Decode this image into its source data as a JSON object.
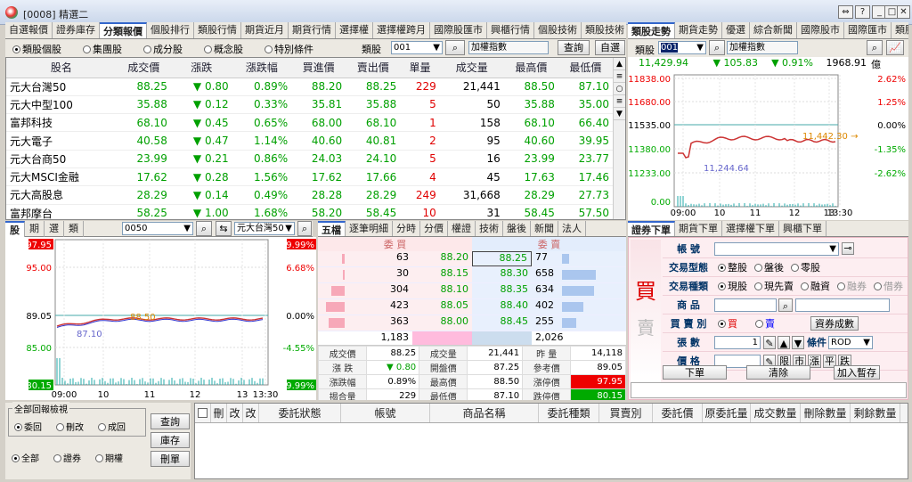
{
  "window": {
    "title": "[0008] 精選二",
    "buttons": [
      "⇔",
      "?",
      "_",
      "□",
      "✕"
    ]
  },
  "main_tabs": [
    "自選報價",
    "證券庫存",
    "分類報價",
    "個股排行",
    "類股行情",
    "期貨近月",
    "期貨行情",
    "選擇權",
    "選擇權跨月",
    "國際股匯市",
    "興櫃行情",
    "個股技術",
    "類股技術",
    "期"
  ],
  "main_tabs_active": 2,
  "right_tabs": [
    "類股走勢",
    "期貨走勢",
    "優選",
    "綜合新聞",
    "國際股市",
    "國際匯市",
    "類股"
  ],
  "right_tabs_active": 0,
  "filter": {
    "options": [
      "類股個股",
      "集團股",
      "成分股",
      "概念股",
      "特別條件"
    ],
    "selected": 0,
    "label": "類股",
    "code": "001",
    "name": "加權指數",
    "query_btn": "查詢",
    "custom_btn": "自選"
  },
  "quote": {
    "headers": [
      "股名",
      "成交價",
      "漲跌",
      "漲跌幅",
      "買進價",
      "賣出價",
      "單量",
      "成交量",
      "最高價",
      "最低價"
    ],
    "rows": [
      [
        "元大台灣50",
        "88.25",
        "0.80",
        "0.89%",
        "88.20",
        "88.25",
        "229",
        "21,441",
        "88.50",
        "87.10"
      ],
      [
        "元大中型100",
        "35.88",
        "0.12",
        "0.33%",
        "35.81",
        "35.88",
        "5",
        "50",
        "35.88",
        "35.00"
      ],
      [
        "富邦科技",
        "68.10",
        "0.45",
        "0.65%",
        "68.00",
        "68.10",
        "1",
        "158",
        "68.10",
        "66.40"
      ],
      [
        "元大電子",
        "40.58",
        "0.47",
        "1.14%",
        "40.60",
        "40.81",
        "2",
        "95",
        "40.60",
        "39.95"
      ],
      [
        "元大台商50",
        "23.99",
        "0.21",
        "0.86%",
        "24.03",
        "24.10",
        "5",
        "16",
        "23.99",
        "23.77"
      ],
      [
        "元大MSCI金融",
        "17.62",
        "0.28",
        "1.56%",
        "17.62",
        "17.66",
        "4",
        "45",
        "17.63",
        "17.46"
      ],
      [
        "元大高股息",
        "28.29",
        "0.14",
        "0.49%",
        "28.28",
        "28.29",
        "249",
        "31,668",
        "28.29",
        "27.73"
      ],
      [
        "富邦摩台",
        "58.25",
        "1.00",
        "1.68%",
        "58.20",
        "58.45",
        "10",
        "31",
        "58.45",
        "57.50"
      ]
    ],
    "scroll_btns": [
      "▲",
      "≡",
      "○",
      "≡",
      "▼"
    ]
  },
  "index": {
    "toolbar_label": "類股",
    "code": "001",
    "name": "加權指數",
    "last": "11,429.94",
    "change": "▼ 105.83",
    "pct": "▼ 0.91%",
    "volume": "1968.91",
    "unit": "億",
    "y_left": [
      "11838.00",
      "11680.00",
      "11535.00",
      "11380.00",
      "11233.00",
      "0.00"
    ],
    "y_right": [
      "2.62%",
      "1.25%",
      "0.00%",
      "-1.35%",
      "-2.62%"
    ],
    "x_labels": [
      "09:00",
      "10",
      "11",
      "12",
      "13",
      "13:30"
    ],
    "high_label": "11,442.30 →",
    "low_label": "11,244.64"
  },
  "stock": {
    "tabs": [
      "股",
      "期",
      "選",
      "類"
    ],
    "code": "0050",
    "name": "元大台灣50",
    "y_left": [
      "97.95",
      "95.00",
      "89.05",
      "85.00",
      "80.15"
    ],
    "y_right": [
      "9.99%",
      "6.68%",
      "0.00%",
      "-4.55%",
      "-9.99%"
    ],
    "x_labels": [
      "09:00",
      "10",
      "11",
      "12",
      "13",
      "13:30"
    ],
    "high_label": "88.50",
    "low_label": "87.10"
  },
  "book": {
    "tabs": [
      "五檔",
      "逐筆明細",
      "分時",
      "分價",
      "權證",
      "技術",
      "盤後",
      "新聞",
      "法人"
    ],
    "bid_label": "委 買",
    "ask_label": "委 賣",
    "rows": [
      {
        "bid_qty": "63",
        "bid": "88.20",
        "ask": "88.25",
        "ask_qty": "77",
        "bw": 0.1,
        "aw": 0.2
      },
      {
        "bid_qty": "30",
        "bid": "88.15",
        "ask": "88.30",
        "ask_qty": "658",
        "bw": 0.08,
        "aw": 0.95
      },
      {
        "bid_qty": "304",
        "bid": "88.10",
        "ask": "88.35",
        "ask_qty": "634",
        "bw": 0.5,
        "aw": 0.9
      },
      {
        "bid_qty": "423",
        "bid": "88.05",
        "ask": "88.40",
        "ask_qty": "402",
        "bw": 0.7,
        "aw": 0.6
      },
      {
        "bid_qty": "363",
        "bid": "88.00",
        "ask": "88.45",
        "ask_qty": "255",
        "bw": 0.6,
        "aw": 0.4
      }
    ],
    "total_bid": "1,183",
    "total_ask": "2,026",
    "stats": [
      [
        "成交價",
        "88.25",
        "成交量",
        "21,441",
        "昨 量",
        "14,118"
      ],
      [
        "漲 跌",
        "▼ 0.80",
        "開盤價",
        "87.25",
        "參考價",
        "89.05"
      ],
      [
        "漲跌幅",
        "0.89%",
        "最高價",
        "88.50",
        "漲停價",
        "97.95"
      ],
      [
        "揭合量",
        "229",
        "最低價",
        "87.10",
        "跌停價",
        "80.15"
      ]
    ]
  },
  "order": {
    "tabs": [
      "證券下單",
      "期貨下單",
      "選擇權下單",
      "興櫃下單"
    ],
    "buy_char1": "買",
    "buy_char2": "賣",
    "account_label": "帳  號",
    "trade_type_label": "交易型態",
    "trade_types": [
      "整股",
      "盤後",
      "零股"
    ],
    "trade_kind_label": "交易種類",
    "trade_kinds": [
      "現股",
      "現先賣",
      "融資",
      "融券",
      "借券"
    ],
    "product_label": "商  品",
    "side_label": "買 賣 別",
    "side_buy": "買",
    "side_sell": "賣",
    "tradable_btn": "資券成數",
    "qty_label": "張  數",
    "qty": "1",
    "cond_label": "條件",
    "cond_value": "ROD",
    "price_label": "價  格",
    "price_btns": [
      "限",
      "市",
      "漲",
      "平",
      "跌"
    ],
    "submit": "下單",
    "clear": "清除",
    "hold": "加入暫存"
  },
  "bottom": {
    "group_title": "全部回報檢視",
    "opts1": [
      "委回",
      "刪改",
      "成回"
    ],
    "opts2": [
      "全部",
      "證券",
      "期權"
    ],
    "btns": [
      "查詢",
      "庫存",
      "刪單"
    ],
    "headers": [
      "刪",
      "改",
      "改",
      "委託狀態",
      "帳號",
      "商品名稱",
      "委託種類",
      "買賣別",
      "委託價",
      "原委託量",
      "成交數量",
      "刪除數量",
      "剩餘數量"
    ]
  },
  "colors": {
    "up": "#e00000",
    "down": "#00a000",
    "accent": "#3366cc"
  }
}
